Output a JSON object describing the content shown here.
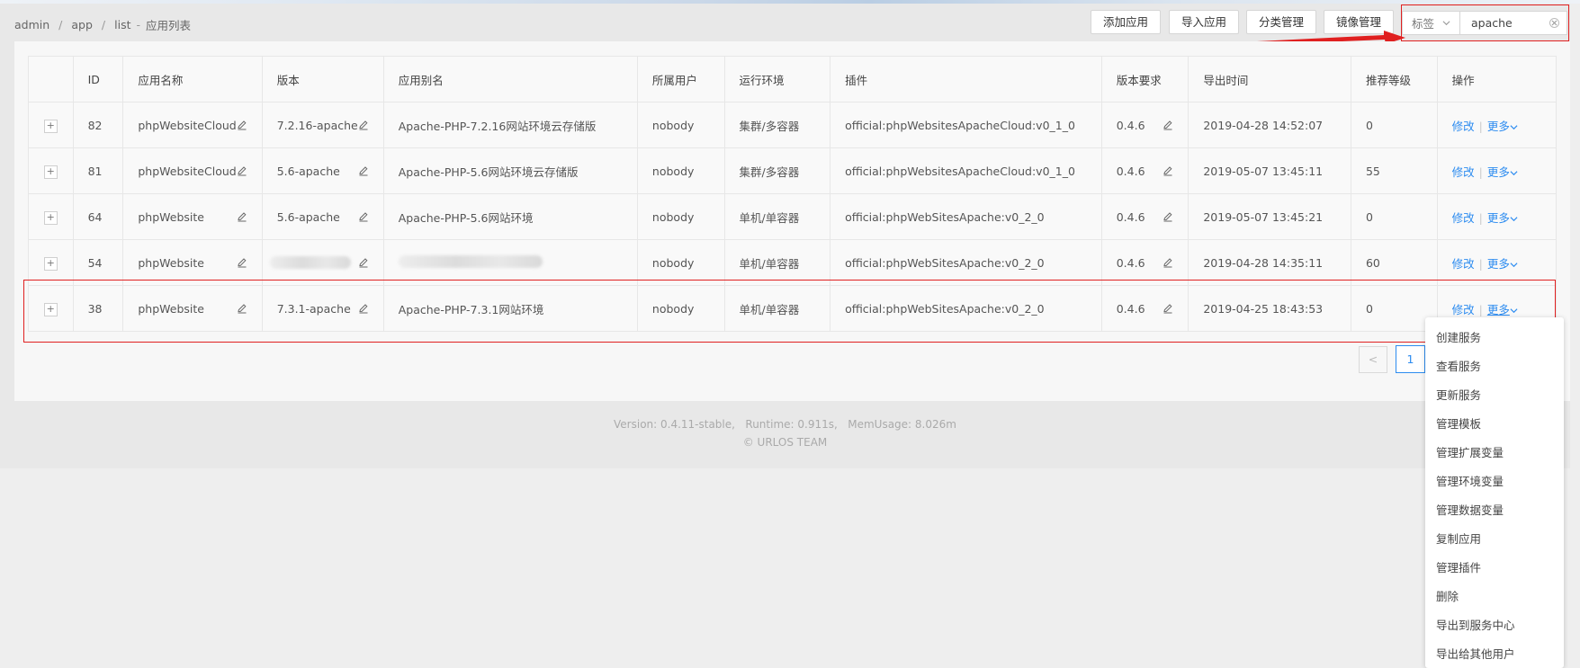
{
  "breadcrumb": {
    "items": [
      "admin",
      "app",
      "list"
    ],
    "separator": "/",
    "title_sep": "-",
    "title": "应用列表"
  },
  "toolbar": {
    "add_app": "添加应用",
    "import_app": "导入应用",
    "category_manage": "分类管理",
    "image_manage": "镜像管理"
  },
  "search": {
    "select_label": "标签",
    "value": "apache"
  },
  "table": {
    "headers": [
      "",
      "ID",
      "应用名称",
      "版本",
      "应用别名",
      "所属用户",
      "运行环境",
      "插件",
      "版本要求",
      "导出时间",
      "推荐等级",
      "操作"
    ],
    "expand_symbol": "+",
    "rows": [
      {
        "id": "82",
        "name": "phpWebsiteCloud",
        "version": "7.2.16-apache",
        "alias": "Apache-PHP-7.2.16网站环境云存储版",
        "user": "nobody",
        "env": "集群/多容器",
        "plugin": "official:phpWebsitesApacheCloud:v0_1_0",
        "req": "0.4.6",
        "time": "2019-04-28 14:52:07",
        "level": "0",
        "blurred": false
      },
      {
        "id": "81",
        "name": "phpWebsiteCloud",
        "version": "5.6-apache",
        "alias": "Apache-PHP-5.6网站环境云存储版",
        "user": "nobody",
        "env": "集群/多容器",
        "plugin": "official:phpWebsitesApacheCloud:v0_1_0",
        "req": "0.4.6",
        "time": "2019-05-07 13:45:11",
        "level": "55",
        "blurred": false
      },
      {
        "id": "64",
        "name": "phpWebsite",
        "version": "5.6-apache",
        "alias": "Apache-PHP-5.6网站环境",
        "user": "nobody",
        "env": "单机/单容器",
        "plugin": "official:phpWebSitesApache:v0_2_0",
        "req": "0.4.6",
        "time": "2019-05-07 13:45:21",
        "level": "0",
        "blurred": false
      },
      {
        "id": "54",
        "name": "phpWebsite",
        "version": "",
        "alias": "",
        "user": "nobody",
        "env": "单机/单容器",
        "plugin": "official:phpWebSitesApache:v0_2_0",
        "req": "0.4.6",
        "time": "2019-04-28 14:35:11",
        "level": "60",
        "blurred": true
      },
      {
        "id": "38",
        "name": "phpWebsite",
        "version": "7.3.1-apache",
        "alias": "Apache-PHP-7.3.1网站环境",
        "user": "nobody",
        "env": "单机/单容器",
        "plugin": "official:phpWebSitesApache:v0_2_0",
        "req": "0.4.6",
        "time": "2019-04-25 18:43:53",
        "level": "0",
        "blurred": false
      }
    ],
    "op_edit": "修改",
    "op_sep": "|",
    "op_more": "更多"
  },
  "pagination": {
    "prev_symbol": "<",
    "current_page": "1"
  },
  "footer": {
    "line1": "Version: 0.4.11-stable,   Runtime: 0.911s,   MemUsage: 8.026m",
    "line2": "© URLOS TEAM"
  },
  "dropdown": {
    "items": [
      "创建服务",
      "查看服务",
      "更新服务",
      "管理模板",
      "管理扩展变量",
      "管理环境变量",
      "管理数据变量",
      "复制应用",
      "管理插件",
      "删除",
      "导出到服务中心",
      "导出给其他用户"
    ]
  },
  "colors": {
    "link": "#2d8cf0",
    "annotation": "#e02020"
  }
}
